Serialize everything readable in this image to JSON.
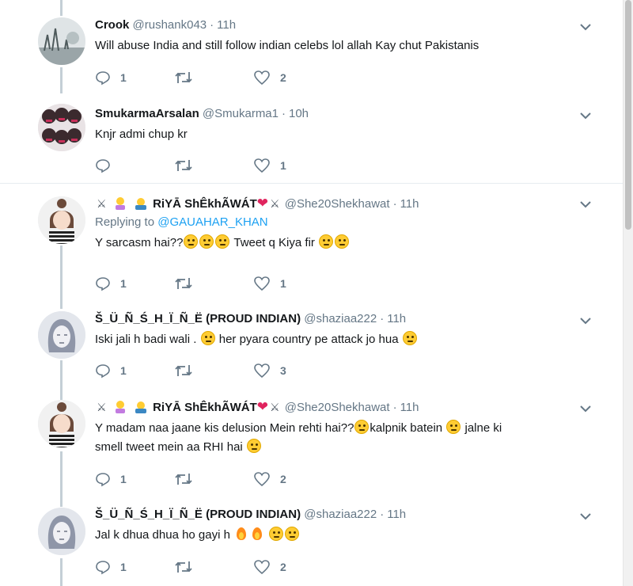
{
  "tweets": [
    {
      "name": "Crook",
      "handle": "@rushank043",
      "time": "11h",
      "text": "Will abuse India and still follow indian celebs lol allah Kay chut Pakistanis",
      "replies": "1",
      "retweets": "",
      "likes": "2"
    },
    {
      "name": "SmukarmaArsalan",
      "handle": "@Smukarma1",
      "time": "10h",
      "text": "Knjr admi chup kr",
      "replies": "",
      "retweets": "",
      "likes": "1"
    },
    {
      "name": "RiYĀ ShÊkhÃWÁT",
      "handle": "@She20Shekhawat",
      "time": "11h",
      "replying_prefix": "Replying to",
      "replying_to": "@GAUAHAR_KHAN",
      "text_a": "Y sarcasm hai??",
      "text_b": "Tweet q Kiya fir",
      "replies": "1",
      "retweets": "",
      "likes": "1"
    },
    {
      "name": "Š_Ü_Ñ_Ś_H_Ï_Ñ_Ë (PROUD INDIAN)",
      "handle": "@shaziaa222",
      "time": "11h",
      "text_a": "Iski jali h badi wali .",
      "text_b": "her pyara country pe attack jo hua",
      "replies": "1",
      "retweets": "",
      "likes": "3"
    },
    {
      "name": "RiYĀ ShÊkhÃWÁT",
      "handle": "@She20Shekhawat",
      "time": "11h",
      "text_a": "Y madam naa jaane kis delusion Mein rehti hai??",
      "text_b": "kalpnik batein",
      "text_c": "jalne ki",
      "text_d": "smell tweet mein aa RHI hai",
      "replies": "1",
      "retweets": "",
      "likes": "2"
    },
    {
      "name": "Š_Ü_Ñ_Ś_H_Ï_Ñ_Ë (PROUD INDIAN)",
      "handle": "@shaziaa222",
      "time": "11h",
      "text": "Jal k dhua dhua ho gayi h",
      "replies": "1",
      "retweets": "",
      "likes": "2"
    }
  ],
  "icons": {
    "reply": "reply-icon",
    "retweet": "retweet-icon",
    "like": "like-icon",
    "more": "chevron-down-icon",
    "separator": "·"
  },
  "colors": {
    "link": "#1da1f2",
    "muted": "#657786",
    "heart": "#e0245e",
    "thread": "#c4cfd6"
  }
}
